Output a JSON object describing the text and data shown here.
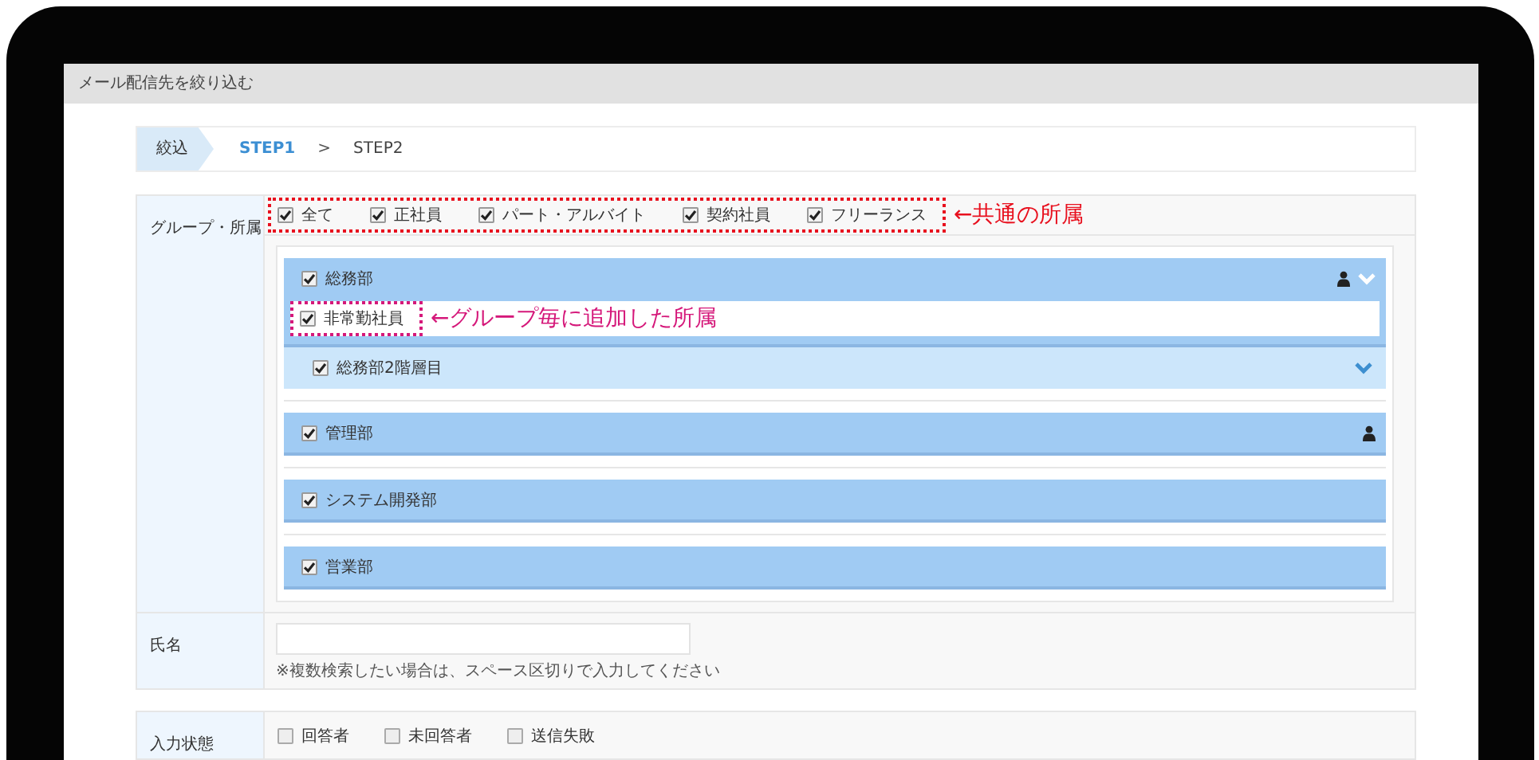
{
  "window": {
    "title": "メール配信先を絞り込む"
  },
  "breadcrumb": {
    "label": "絞込",
    "separator": ">",
    "steps": [
      {
        "label": "STEP1",
        "selected": true
      },
      {
        "label": "STEP2",
        "selected": false
      }
    ]
  },
  "group_field": {
    "label": "グループ・所属",
    "annotation": "←共通の所属",
    "common_options": [
      {
        "label": "全て",
        "checked": true
      },
      {
        "label": "正社員",
        "checked": true
      },
      {
        "label": "パート・アルバイト",
        "checked": true
      },
      {
        "label": "契約社員",
        "checked": true
      },
      {
        "label": "フリーランス",
        "checked": true
      }
    ],
    "groups": [
      {
        "name": "総務部",
        "checked": true,
        "member_icon": true,
        "toggle": true,
        "annotation": "←グループ毎に追加した所属",
        "affiliations": [
          {
            "label": "非常勤社員",
            "checked": true
          }
        ],
        "children": [
          {
            "name": "総務部2階層目",
            "checked": true,
            "toggle": true
          }
        ]
      },
      {
        "name": "管理部",
        "checked": true,
        "member_icon": true,
        "toggle": false
      },
      {
        "name": "システム開発部",
        "checked": true,
        "member_icon": false,
        "toggle": false
      },
      {
        "name": "営業部",
        "checked": true,
        "member_icon": false,
        "toggle": false
      }
    ]
  },
  "name_field": {
    "label": "氏名",
    "note": "※複数検索したい場合は、スペース区切りで入力してください"
  },
  "status_field": {
    "label": "入力状態",
    "options": [
      {
        "label": "回答者",
        "checked": false
      },
      {
        "label": "未回答者",
        "checked": false
      },
      {
        "label": "送信失敗",
        "checked": false
      }
    ]
  }
}
